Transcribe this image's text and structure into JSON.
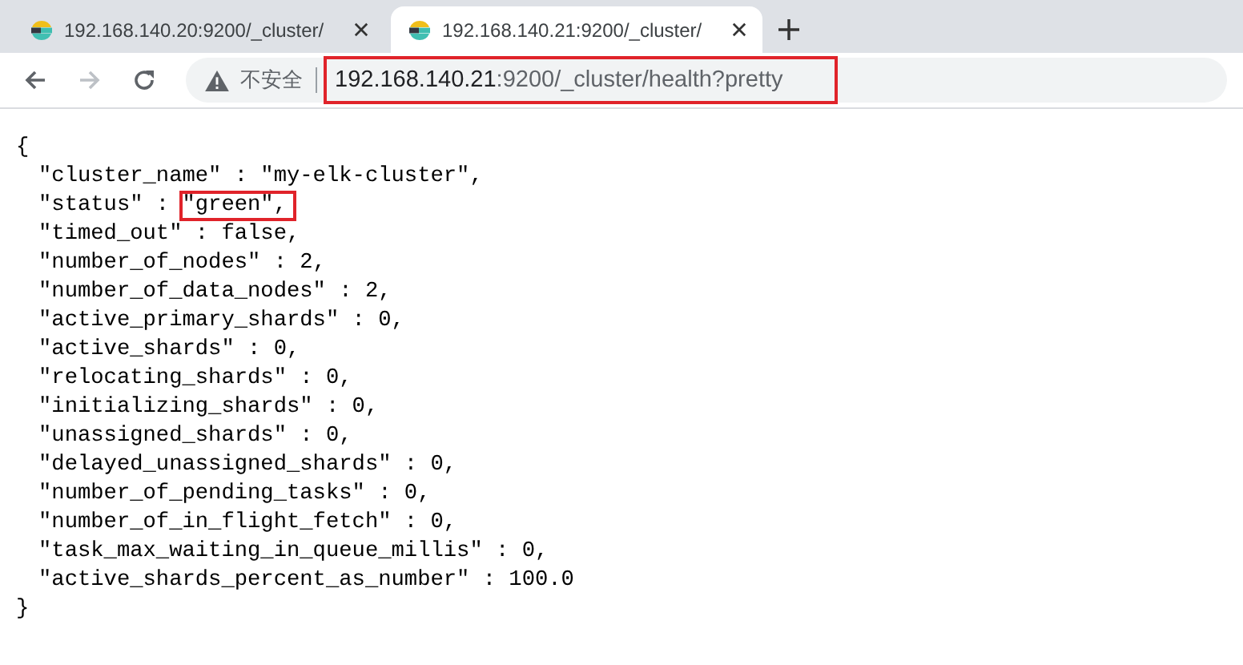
{
  "tabs": [
    {
      "title": "192.168.140.20:9200/_cluster/",
      "selected": false
    },
    {
      "title": "192.168.140.21:9200/_cluster/",
      "selected": true
    }
  ],
  "address_bar": {
    "security_label": "不安全",
    "host": "192.168.140.21",
    "path": ":9200/_cluster/health?pretty",
    "highlighted": true
  },
  "open_brace": "{",
  "fields": [
    {
      "text": "\"cluster_name\" : \"my-elk-cluster\","
    },
    {
      "text": "\"status\" : ",
      "highlight": "\"green\","
    },
    {
      "text": "\"timed_out\" : false,"
    },
    {
      "text": "\"number_of_nodes\" : 2,"
    },
    {
      "text": "\"number_of_data_nodes\" : 2,"
    },
    {
      "text": "\"active_primary_shards\" : 0,"
    },
    {
      "text": "\"active_shards\" : 0,"
    },
    {
      "text": "\"relocating_shards\" : 0,"
    },
    {
      "text": "\"initializing_shards\" : 0,"
    },
    {
      "text": "\"unassigned_shards\" : 0,"
    },
    {
      "text": "\"delayed_unassigned_shards\" : 0,"
    },
    {
      "text": "\"number_of_pending_tasks\" : 0,"
    },
    {
      "text": "\"number_of_in_flight_fetch\" : 0,"
    },
    {
      "text": "\"task_max_waiting_in_queue_millis\" : 0,"
    },
    {
      "text": "\"active_shards_percent_as_number\" : 100.0"
    }
  ],
  "close_brace": "}"
}
